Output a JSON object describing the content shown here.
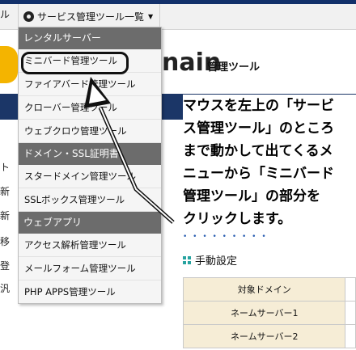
{
  "topbar": {
    "left_label": "ル",
    "menu_label": "サービス管理ツール一覧"
  },
  "background": {
    "logo_text": "nain",
    "logo_subtitle": "管理ツール",
    "left_column": [
      "ト",
      "新",
      "新",
      "移",
      "登",
      "汎"
    ],
    "manual_setting": "手動設定",
    "table_rows": [
      {
        "label": "対象ドメイン",
        "value": ""
      },
      {
        "label": "ネームサーバー1",
        "value": ""
      },
      {
        "label": "ネームサーバー2",
        "value": ""
      }
    ]
  },
  "dropdown": {
    "sections": [
      {
        "title": "レンタルサーバー",
        "items": [
          "ミニバード管理ツール",
          "ファイアバード管理ツール",
          "クローバー管理ツール",
          "ウェブクロウ管理ツール"
        ]
      },
      {
        "title": "ドメイン・SSL証明書",
        "items": [
          "スタードメイン管理ツール",
          "SSLボックス管理ツール"
        ]
      },
      {
        "title": "ウェブアプリ",
        "items": [
          "アクセス解析管理ツール",
          "メールフォーム管理ツール",
          "PHP APPS管理ツール"
        ]
      }
    ]
  },
  "instruction": {
    "lines": [
      "マウスを左上の「サービ",
      "ス管理ツール」のところ",
      "まで動かして出てくるメ",
      "ニューから「ミニバード",
      "管理ツール」の部分を",
      "クリックします。"
    ]
  },
  "colors": {
    "section_bg": "#6c6c6c",
    "nav_bg": "#1b3667",
    "table_label_bg": "#f6edd6",
    "logo_accent": "#f4b400"
  }
}
